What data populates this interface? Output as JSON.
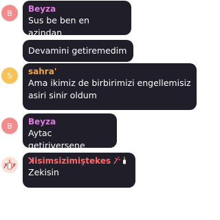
{
  "messages": [
    {
      "avatar_letter": "B",
      "author": "Beyza",
      "author_color": "#e07be0",
      "text": "Sus be ben en azindan"
    },
    {
      "text": "Devamini getiremedim"
    },
    {
      "avatar_letter": "S",
      "author": "sahra'",
      "author_color": "#f2a64a",
      "text": "Ama ikimiz de birbirimizi engellemisiz\nasiri sinir oldum"
    },
    {
      "avatar_letter": "B",
      "author": "Beyza",
      "author_color": "#e07be0",
      "text": "Aytac getiriversene"
    },
    {
      "avatar_icon": "profile-image-icon",
      "author": "ꓘisimsizimiştekes",
      "author_color": "#ff6b6b",
      "author_suffix_icons": [
        "wand-icon",
        "candle-icon"
      ],
      "text": "Zekisin"
    }
  ]
}
